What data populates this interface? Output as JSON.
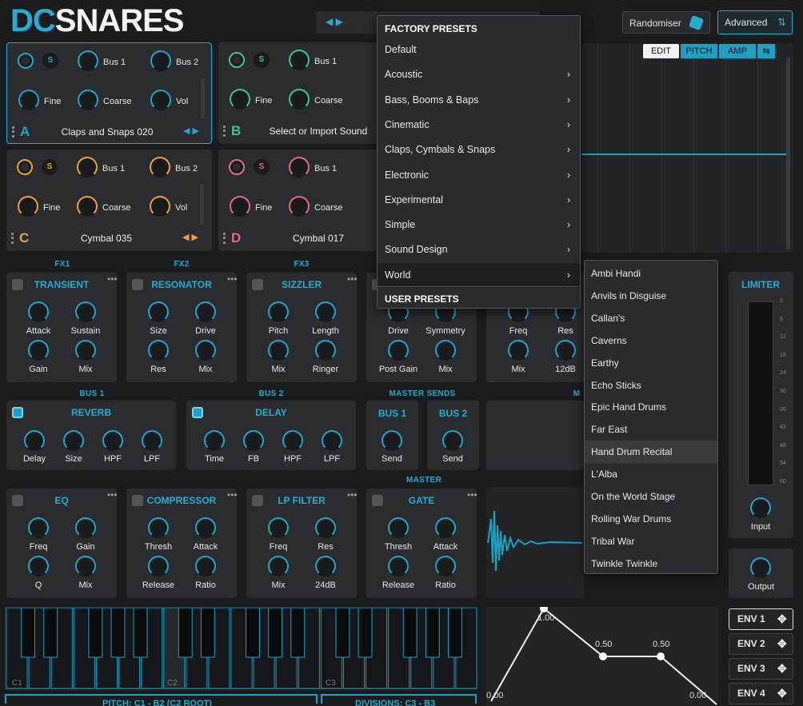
{
  "brand": {
    "dc": "DC",
    "snares": "SNARES"
  },
  "top": {
    "randomiser": "Randomiser",
    "advanced": "Advanced"
  },
  "slots": [
    {
      "letter": "A",
      "s": "S",
      "bus1": "Bus 1",
      "bus2": "Bus 2",
      "fine": "Fine",
      "coarse": "Coarse",
      "vol": "Vol",
      "name": "Claps and Snaps 020",
      "color": "#25a3c8"
    },
    {
      "letter": "B",
      "s": "S",
      "bus1": "Bus 1",
      "bus2": "",
      "fine": "Fine",
      "coarse": "Coarse",
      "vol": "",
      "name": "Select or Import Sound",
      "color": "#3dc48c"
    },
    {
      "letter": "C",
      "s": "S",
      "bus1": "Bus 1",
      "bus2": "Bus 2",
      "fine": "Fine",
      "coarse": "Coarse",
      "vol": "Vol",
      "name": "Cymbal 035",
      "color": "#e8a33a"
    },
    {
      "letter": "D",
      "s": "S",
      "bus1": "Bus 1",
      "bus2": "",
      "fine": "Fine",
      "coarse": "Coarse",
      "vol": "",
      "name": "Cymbal 017",
      "color": "#e46a82"
    }
  ],
  "editor_tabs": [
    "EDIT",
    "PITCH",
    "AMP",
    "⇆"
  ],
  "fx_labels": {
    "fx1": "FX1",
    "fx2": "FX2",
    "fx3": "FX3"
  },
  "fx": [
    {
      "title": "TRANSIENT",
      "k": [
        "Attack",
        "Sustain",
        "Gain",
        "Mix"
      ]
    },
    {
      "title": "RESONATOR",
      "k": [
        "Size",
        "Drive",
        "Res",
        "Mix"
      ]
    },
    {
      "title": "SIZZLER",
      "k": [
        "Pitch",
        "Length",
        "Mix",
        "Ringer"
      ]
    },
    {
      "title": "",
      "k": [
        "Drive",
        "Symmetry",
        "Post Gain",
        "Mix"
      ]
    },
    {
      "title": "",
      "k": [
        "Freq",
        "Res",
        "Mix",
        "12dB"
      ]
    }
  ],
  "bus_labels": {
    "bus1": "BUS 1",
    "bus2": "BUS 2",
    "sends": "MASTER SENDS",
    "m": "M",
    "master": "MASTER"
  },
  "reverb": {
    "title": "REVERB",
    "k": [
      "Delay",
      "Size",
      "HPF",
      "LPF"
    ]
  },
  "delay": {
    "title": "DELAY",
    "k": [
      "Time",
      "FB",
      "HPF",
      "LPF"
    ]
  },
  "sends": [
    {
      "title": "BUS 1",
      "k": "Send"
    },
    {
      "title": "BUS 2",
      "k": "Send"
    }
  ],
  "master": [
    {
      "title": "EQ",
      "k": [
        "Freq",
        "Gain",
        "Q",
        "Mix"
      ]
    },
    {
      "title": "COMPRESSOR",
      "k": [
        "Thresh",
        "Attack",
        "Release",
        "Ratio"
      ]
    },
    {
      "title": "LP FILTER",
      "k": [
        "Freq",
        "Res",
        "Mix",
        "24dB"
      ]
    },
    {
      "title": "GATE",
      "k": [
        "Thresh",
        "Attack",
        "Release",
        "Ratio"
      ]
    }
  ],
  "limiter": {
    "title": "LIMITER",
    "input": "Input",
    "output": "Output",
    "scale": [
      "0",
      "6",
      "12",
      "18",
      "24",
      "30",
      "36",
      "42",
      "48",
      "54",
      "60"
    ]
  },
  "keyboard": {
    "c1": "C1",
    "c2": "C2",
    "c3": "C3",
    "pitch": "PITCH: C1 - B2 (C2 ROOT)",
    "divisions": "DIVISIONS: C3 - B3"
  },
  "envelope": {
    "points": [
      "1.00",
      "0.50",
      "0.50",
      "0.00",
      "0.00"
    ]
  },
  "env_buttons": [
    "ENV 1",
    "ENV 2",
    "ENV 3",
    "ENV 4"
  ],
  "presets": {
    "factory_header": "FACTORY PRESETS",
    "items": [
      "Default",
      "Acoustic",
      "Bass, Booms & Baps",
      "Cinematic",
      "Claps, Cymbals & Snaps",
      "Electronic",
      "Experimental",
      "Simple",
      "Sound Design",
      "World"
    ],
    "user_header": "USER PRESETS"
  },
  "world_submenu": [
    "Ambi Handi",
    "Anvils in Disguise",
    "Callan's",
    "Caverns",
    "Earthy",
    "Echo Sticks",
    "Epic Hand Drums",
    "Far East",
    "Hand Drum Recital",
    "L'Alba",
    "On the World Stage",
    "Rolling War Drums",
    "Tribal War",
    "Twinkle Twinkle"
  ]
}
